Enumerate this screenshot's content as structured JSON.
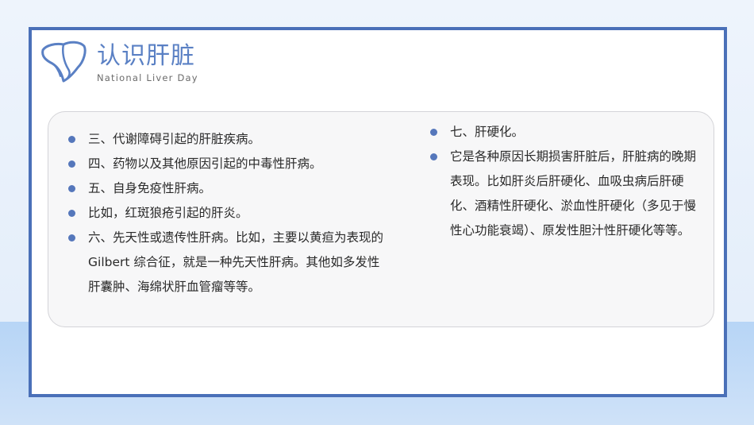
{
  "header": {
    "title": "认识肝脏",
    "subtitle": "National Liver Day",
    "logo_icon": "liver-icon"
  },
  "colors": {
    "frame_border": "#4a70b8",
    "title_color": "#5a80c4",
    "bullet_color": "#5577bb",
    "panel_bg": "#f7f7f8"
  },
  "left_list": [
    "三、代谢障碍引起的肝脏疾病。",
    "四、药物以及其他原因引起的中毒性肝病。",
    "五、自身免疫性肝病。",
    "比如，红斑狼疮引起的肝炎。",
    "六、先天性或遗传性肝病。比如，主要以黄疸为表现的 Gilbert 综合征，就是一种先天性肝病。其他如多发性肝囊肿、海绵状肝血管瘤等等。"
  ],
  "right_list": [
    "七、肝硬化。",
    "它是各种原因长期损害肝脏后，肝脏病的晚期表现。比如肝炎后肝硬化、血吸虫病后肝硬化、酒精性肝硬化、淤血性肝硬化（多见于慢性心功能衰竭）、原发性胆汁性肝硬化等等。"
  ]
}
